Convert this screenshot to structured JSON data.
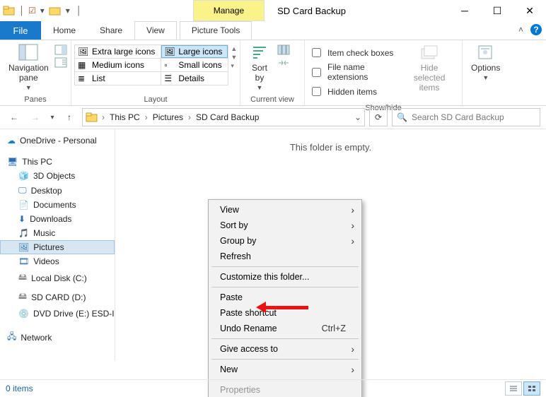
{
  "titlebar": {
    "manage": "Manage",
    "title": "SD Card Backup"
  },
  "tabs": {
    "file": "File",
    "home": "Home",
    "share": "Share",
    "view": "View",
    "picture": "Picture Tools"
  },
  "ribbon": {
    "panes": {
      "nav": "Navigation\npane",
      "label": "Panes"
    },
    "layout": {
      "xl": "Extra large icons",
      "lg": "Large icons",
      "md": "Medium icons",
      "sm": "Small icons",
      "list": "List",
      "details": "Details",
      "label": "Layout"
    },
    "current": {
      "sort": "Sort\nby",
      "label": "Current view"
    },
    "showhide": {
      "chk_boxes": "Item check boxes",
      "chk_ext": "File name extensions",
      "chk_hidden": "Hidden items",
      "hide": "Hide selected\nitems",
      "label": "Show/hide"
    },
    "options": "Options"
  },
  "addr": {
    "crumbs": [
      "This PC",
      "Pictures",
      "SD Card Backup"
    ],
    "search_placeholder": "Search SD Card Backup"
  },
  "tree": {
    "onedrive": "OneDrive - Personal",
    "thispc": "This PC",
    "items": [
      "3D Objects",
      "Desktop",
      "Documents",
      "Downloads",
      "Music",
      "Pictures",
      "Videos",
      "Local Disk (C:)",
      "SD CARD (D:)",
      "DVD Drive (E:) ESD-IS"
    ],
    "network": "Network"
  },
  "content": {
    "empty": "This folder is empty."
  },
  "ctx": {
    "view": "View",
    "sortby": "Sort by",
    "groupby": "Group by",
    "refresh": "Refresh",
    "customize": "Customize this folder...",
    "paste": "Paste",
    "paste_shortcut": "Paste shortcut",
    "undo": "Undo Rename",
    "undo_sc": "Ctrl+Z",
    "giveaccess": "Give access to",
    "new": "New",
    "properties": "Properties"
  },
  "status": {
    "items": "0 items"
  }
}
